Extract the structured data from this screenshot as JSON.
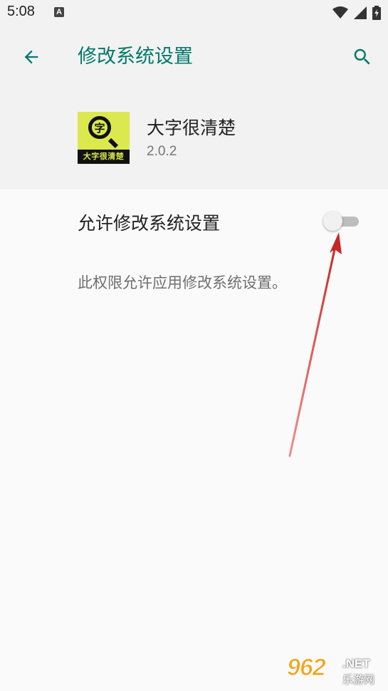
{
  "status_bar": {
    "time": "5:08",
    "notification_icon_letter": "A",
    "icons": [
      "wifi-icon",
      "signal-icon",
      "battery-icon"
    ]
  },
  "header": {
    "title": "修改系统设置",
    "back_icon": "arrow-left-icon",
    "search_icon": "search-icon"
  },
  "app": {
    "name": "大字很清楚",
    "version": "2.0.2",
    "icon_glyph": "字",
    "icon_band_text": "大字很清楚",
    "icon_bg_color": "#dbe94e"
  },
  "setting": {
    "label": "允许修改系统设置",
    "enabled": false,
    "description": "此权限允许应用修改系统设置。"
  },
  "watermark": {
    "number": "962",
    "net": ".NET",
    "cn": "乐游网"
  },
  "colors": {
    "accent": "#00796b",
    "annotation_arrow": "#d32f2f"
  }
}
